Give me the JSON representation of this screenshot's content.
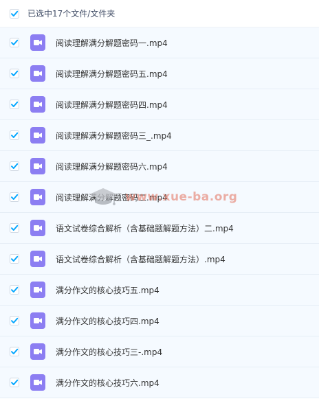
{
  "header": {
    "selection_label": "已选中17个文件/文件夹",
    "checked": true
  },
  "files": [
    {
      "name": "阅读理解满分解题密码一.mp4",
      "checked": true,
      "icon": "video-file-icon"
    },
    {
      "name": "阅读理解满分解题密码五.mp4",
      "checked": true,
      "icon": "video-file-icon"
    },
    {
      "name": "阅读理解满分解题密码四.mp4",
      "checked": true,
      "icon": "video-file-icon"
    },
    {
      "name": "阅读理解满分解题密码三_.mp4",
      "checked": true,
      "icon": "video-file-icon"
    },
    {
      "name": "阅读理解满分解题密码六.mp4",
      "checked": true,
      "icon": "video-file-icon"
    },
    {
      "name": "阅读理解满分解题密码二.mp4",
      "checked": true,
      "icon": "video-file-icon"
    },
    {
      "name": "语文试卷综合解析（含基础题解题方法）二.mp4",
      "checked": true,
      "icon": "video-file-icon"
    },
    {
      "name": "语文试卷综合解析（含基础题解题方法）.mp4",
      "checked": true,
      "icon": "video-file-icon"
    },
    {
      "name": "满分作文的核心技巧五.mp4",
      "checked": true,
      "icon": "video-file-icon"
    },
    {
      "name": "满分作文的核心技巧四.mp4",
      "checked": true,
      "icon": "video-file-icon"
    },
    {
      "name": "满分作文的核心技巧三-.mp4",
      "checked": true,
      "icon": "video-file-icon"
    },
    {
      "name": "满分作文的核心技巧六.mp4",
      "checked": true,
      "icon": "video-file-icon"
    }
  ],
  "watermark": {
    "text": "www.xue-ba.org",
    "icon": "graduation-cap-icon"
  },
  "colors": {
    "checkbox_blue": "#06a7ff",
    "video_icon_purple": "#8c7ef2",
    "row_background": "#f5faff",
    "row_border": "#e6eef6",
    "watermark_red": "#e26e5a"
  }
}
